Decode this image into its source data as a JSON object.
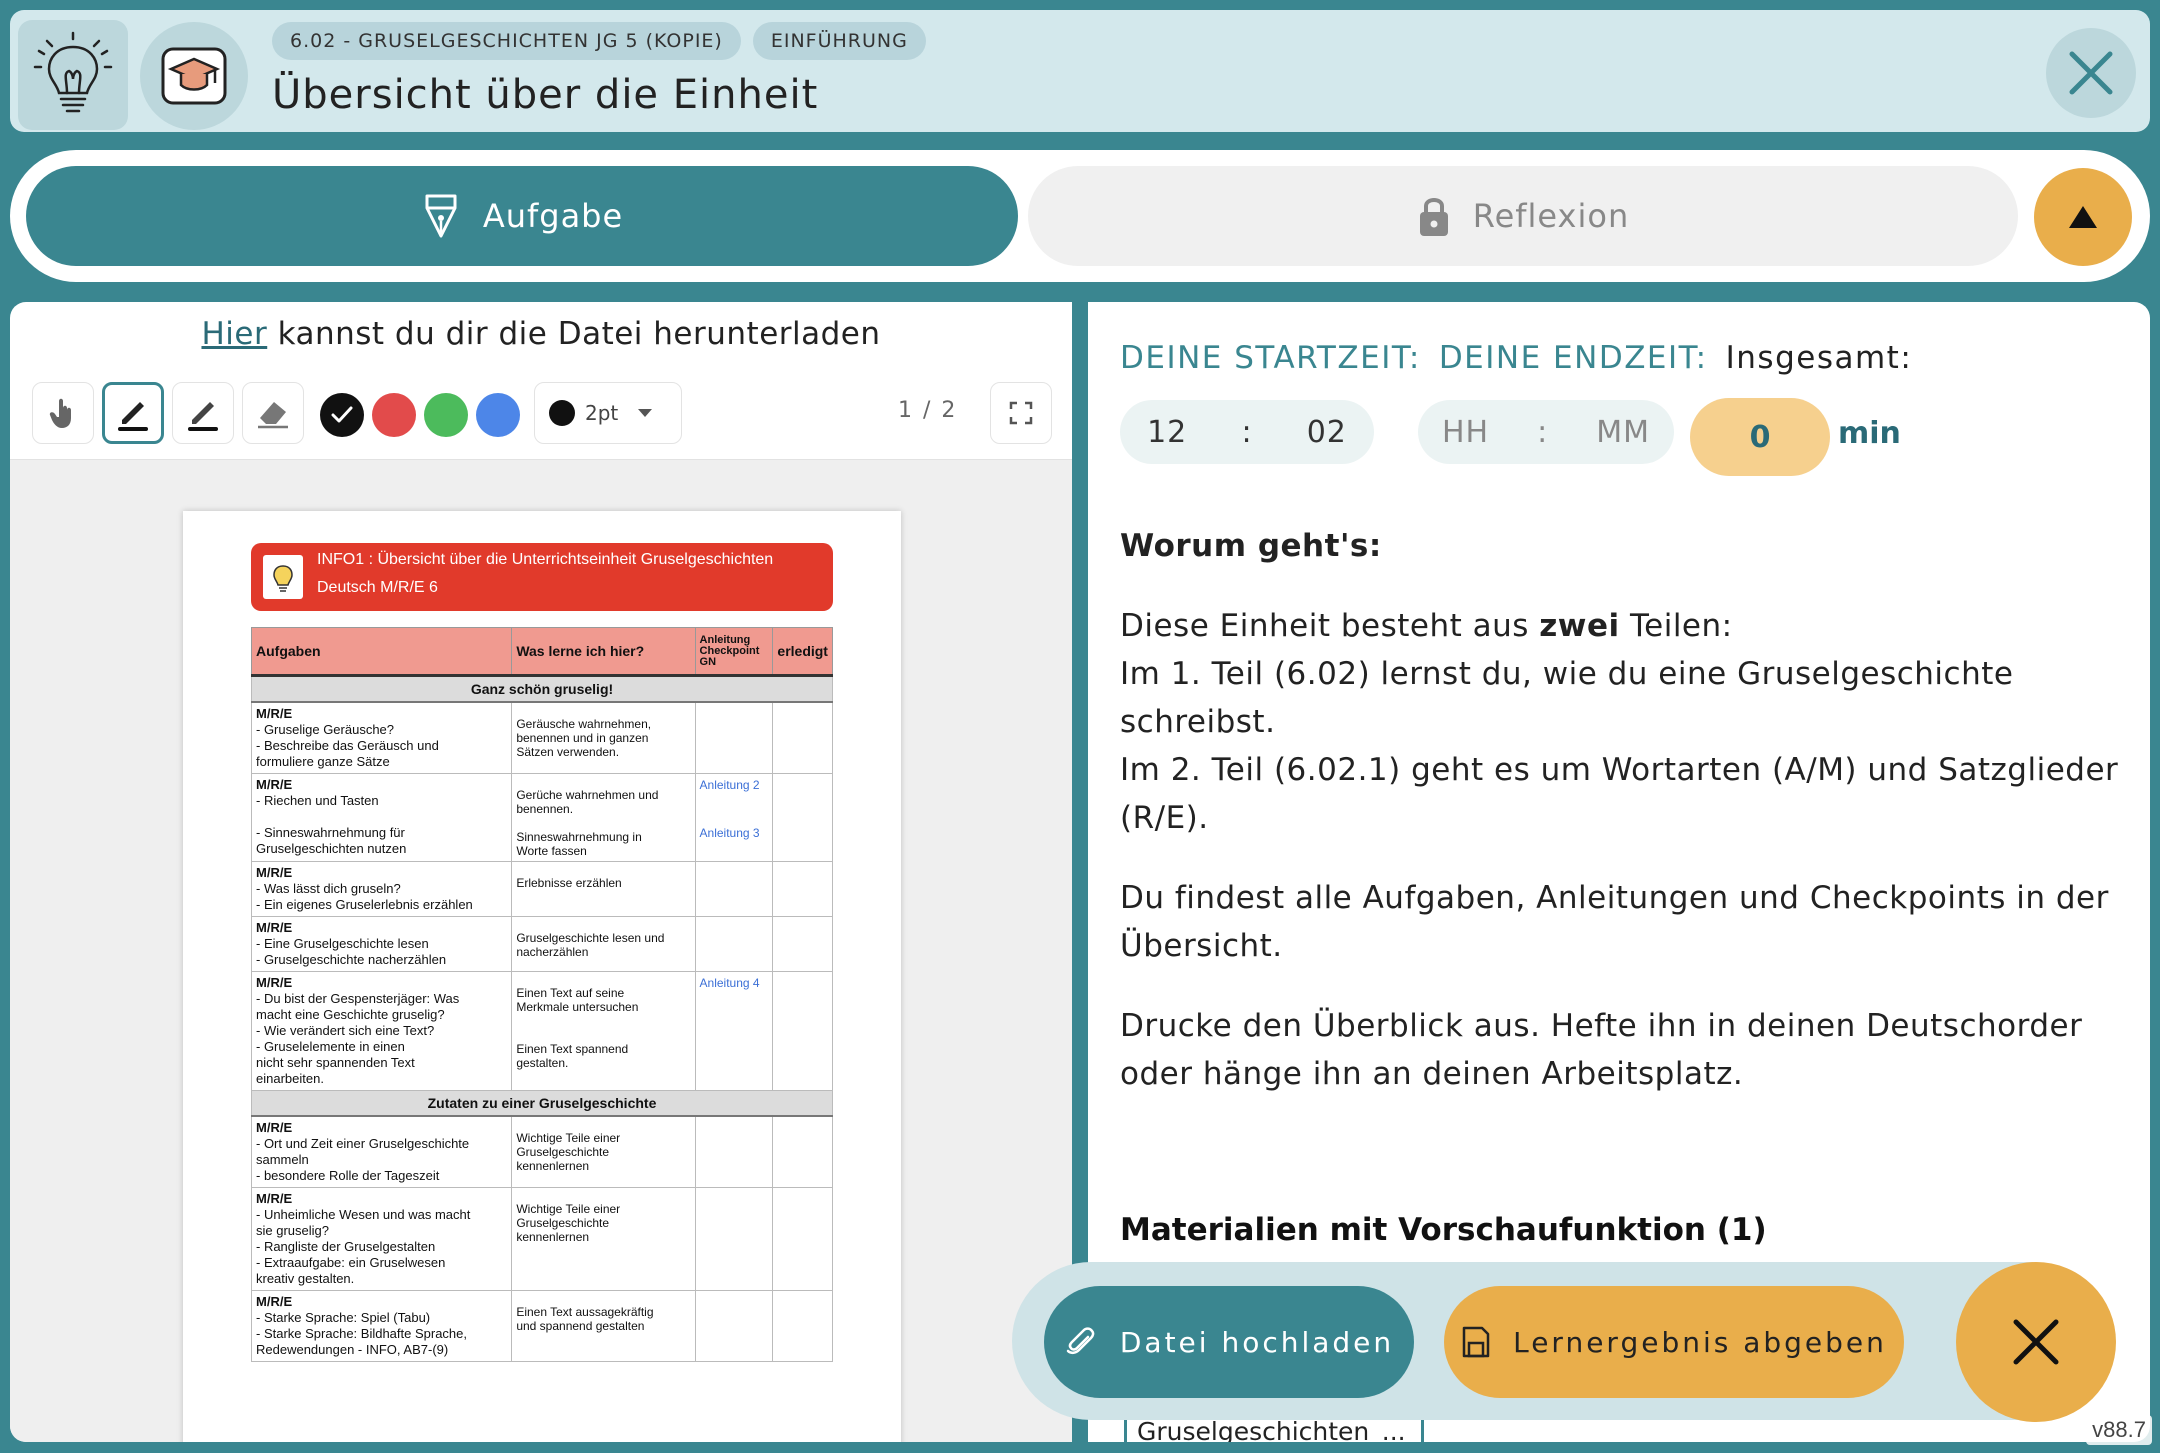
{
  "header": {
    "breadcrumbs": [
      "6.02 - GRUSELGESCHICHTEN JG 5 (KOPIE)",
      "EINFÜHRUNG"
    ],
    "title": "Übersicht über die Einheit"
  },
  "tabs": [
    {
      "label": "Aufgabe",
      "icon": "pen-nib-icon",
      "active": true
    },
    {
      "label": "Reflexion",
      "icon": "lock-icon",
      "active": false
    }
  ],
  "left": {
    "download_prefix": "Hier",
    "download_suffix": " kannst du dir die Datei herunterladen",
    "pen_size": "2pt",
    "pager": "1 / 2",
    "colors": [
      "#111111",
      "#e24b4b",
      "#4cbb5c",
      "#4d86e8"
    ]
  },
  "document": {
    "banner_line1": "INFO1 : Übersicht über die Unterrichtseinheit Gruselgeschichten",
    "banner_line2": "Deutsch M/R/E 6",
    "columns": [
      "Aufgaben",
      "Was lerne ich hier?",
      "Anleitung Checkpoint GN",
      "erledigt"
    ],
    "section1": "Ganz schön gruselig!",
    "section2": "Zutaten zu einer Gruselgeschichte",
    "rows": [
      {
        "level": "M/R/E",
        "tasks": "- Gruselige Geräusche?\n- Beschreibe das Geräusch und\n  formuliere ganze Sätze",
        "learn": "Geräusche wahrnehmen,\nbenennen und in ganzen\nSätzen verwenden.",
        "guide": ""
      },
      {
        "level": "M/R/E",
        "tasks": "- Riechen und Tasten\n\n- Sinneswahrnehmung für\n  Gruselgeschichten nutzen",
        "learn": "Gerüche wahrnehmen und\nbenennen.\n\nSinneswahrnehmung in\nWorte fassen",
        "guide": "Anleitung 2\n\n\nAnleitung 3"
      },
      {
        "level": "M/R/E",
        "tasks": "- Was lässt dich gruseln?\n- Ein eigenes Gruselerlebnis erzählen",
        "learn": "Erlebnisse erzählen",
        "guide": ""
      },
      {
        "level": "M/R/E",
        "tasks": "- Eine Gruselgeschichte lesen\n- Gruselgeschichte nacherzählen",
        "learn": "Gruselgeschichte lesen und\nnacherzählen",
        "guide": ""
      },
      {
        "level": "M/R/E",
        "tasks": "- Du bist der Gespensterjäger: Was\n  macht eine Geschichte gruselig?\n- Wie verändert sich eine Text?\n- Gruselelemente in einen\n  nicht sehr spannenden Text\n  einarbeiten.",
        "learn": "Einen Text auf seine\nMerkmale untersuchen\n\n\nEinen Text spannend\ngestalten.",
        "guide": "Anleitung 4"
      },
      {
        "level": "M/R/E",
        "tasks": "- Ort und Zeit einer Gruselgeschichte\n  sammeln\n- besondere Rolle der Tageszeit",
        "learn": "Wichtige Teile einer\nGruselgeschichte\nkennenlernen",
        "guide": ""
      },
      {
        "level": "M/R/E",
        "tasks": "- Unheimliche Wesen und was macht\n  sie gruselig?\n- Rangliste der Gruselgestalten\n- Extraaufgabe: ein Gruselwesen\n  kreativ gestalten.",
        "learn": "Wichtige Teile einer\nGruselgeschichte\nkennenlernen",
        "guide": ""
      },
      {
        "level": "M/R/E",
        "tasks": "- Starke Sprache: Spiel (Tabu)\n- Starke Sprache: Bildhafte Sprache,\n  Redewendungen - INFO, AB7-(9)",
        "learn": "Einen Text aussagekräftig\nund spannend gestalten",
        "guide": ""
      }
    ]
  },
  "time": {
    "start_label": "DEINE STARTZEIT:",
    "end_label": "DEINE ENDZEIT:",
    "total_label": "Insgesamt:",
    "start_hour": "12",
    "start_minute": "02",
    "end_hour_placeholder": "HH",
    "end_minute_placeholder": "MM",
    "separator": ":",
    "total_minutes": "0",
    "unit": "min"
  },
  "content": {
    "heading": "Worum geht's:",
    "p1_before": "Diese Einheit besteht aus ",
    "p1_bold": "zwei",
    "p1_after": " Teilen:",
    "p1_line2": "Im 1. Teil (6.02) lernst du, wie du eine Gruselgeschichte schreibst.",
    "p1_line3": "Im 2. Teil (6.02.1) geht es um Wortarten (A/M) und Satzglieder (R/E).",
    "p2": "Du findest alle Aufgaben, Anleitungen und Checkpoints in der Übersicht.",
    "p3": "Drucke den Überblick aus. Hefte ihn in deinen Deutschorder oder hänge ihn an deinen Arbeitsplatz.",
    "materials_heading": "Materialien mit Vorschaufunktion (1)",
    "file_name": "Gruselgeschichten_..."
  },
  "actions": {
    "upload_label": "Datei hochladen",
    "submit_label": "Lernergebnis abgeben"
  },
  "version": "v88.7",
  "colors": {
    "teal": "#3a8690",
    "light_teal": "#d3e8ec",
    "orange": "#e9ae4b",
    "doc_red": "#e13a2b"
  }
}
